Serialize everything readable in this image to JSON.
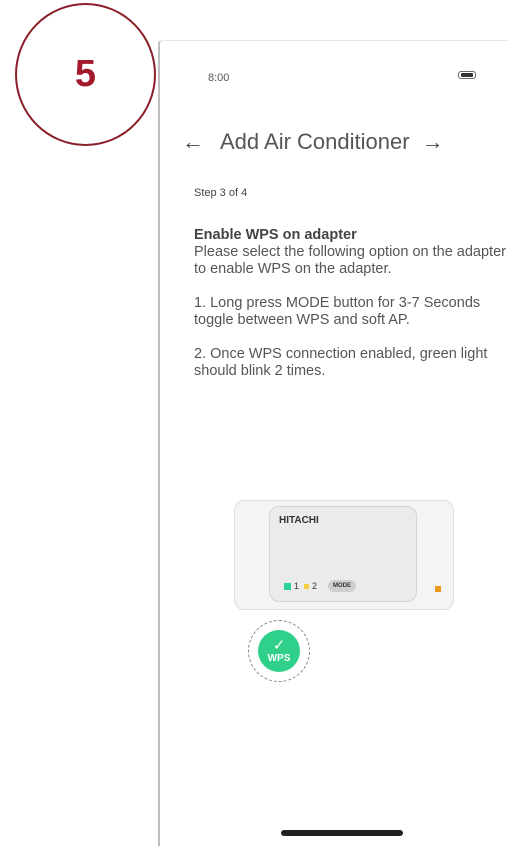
{
  "step_badge": {
    "number": "5",
    "color": "#a3192c"
  },
  "status_bar": {
    "time": "8:00",
    "battery_icon": "battery-icon"
  },
  "header": {
    "title": "Add Air Conditioner",
    "back_icon": "arrow-left-icon",
    "next_icon": "arrow-right-icon"
  },
  "step_indicator": "Step 3 of 4",
  "instructions": {
    "heading": "Enable WPS on adapter",
    "intro": "Please select the following option on the adapter to enable WPS on the adapter.",
    "step1": "1. Long press MODE button for 3-7 Seconds toggle between WPS and soft AP.",
    "step2": "2. Once WPS connection enabled, green light should blink 2 times."
  },
  "adapter": {
    "brand": "HITACHI",
    "led1_label": "1",
    "led2_label": "2",
    "mode_label": "MODE",
    "led_colors": {
      "green": "#2ed29b",
      "yellow": "#f1cf3f",
      "orange": "#ef9a1f"
    }
  },
  "wps_badge": {
    "label": "WPS",
    "check_icon": "check-icon",
    "color": "#2fd08a"
  }
}
